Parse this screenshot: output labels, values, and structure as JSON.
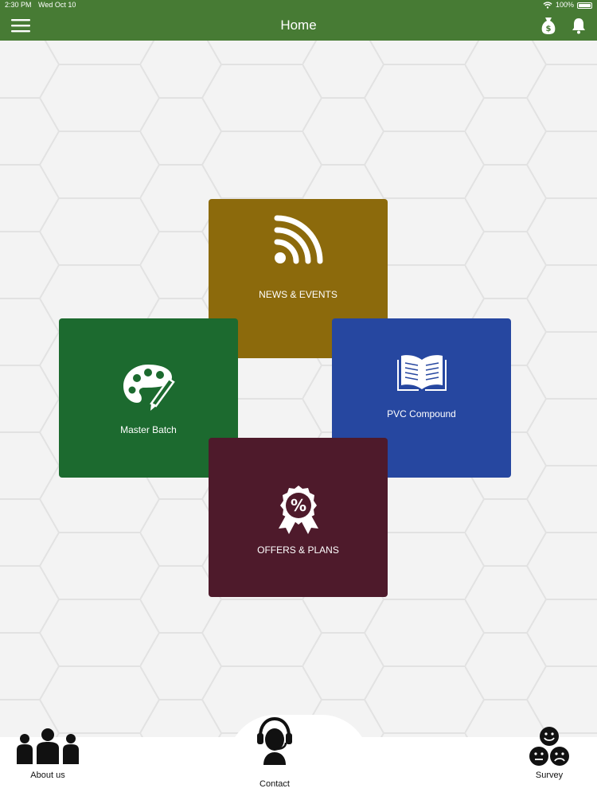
{
  "status_bar": {
    "time": "2:30 PM",
    "date": "Wed Oct 10",
    "battery": "100%",
    "icons": [
      "wifi-icon",
      "battery-icon"
    ]
  },
  "nav_bar": {
    "title": "Home",
    "left_icon": "hamburger-menu-icon",
    "right_icons": [
      "money-bag-icon",
      "bell-icon"
    ]
  },
  "tiles": [
    {
      "label": "NEWS & EVENTS",
      "icon": "rss-icon",
      "color": "#8c6a0c"
    },
    {
      "label": "Master Batch",
      "icon": "palette-icon",
      "color": "#1c6a2f"
    },
    {
      "label": "PVC Compound",
      "icon": "open-book-icon",
      "color": "#2647a0"
    },
    {
      "label": "OFFERS & PLANS",
      "icon": "discount-badge-icon",
      "color": "#4e1a2b"
    }
  ],
  "bottom_nav": {
    "about": {
      "label": "About us",
      "icon": "group-icon"
    },
    "contact": {
      "label": "Contact",
      "icon": "headset-icon"
    },
    "survey": {
      "label": "Survey",
      "icon": "smiley-faces-icon"
    }
  },
  "colors": {
    "header": "#477b34",
    "background": "#f3f3f3"
  }
}
